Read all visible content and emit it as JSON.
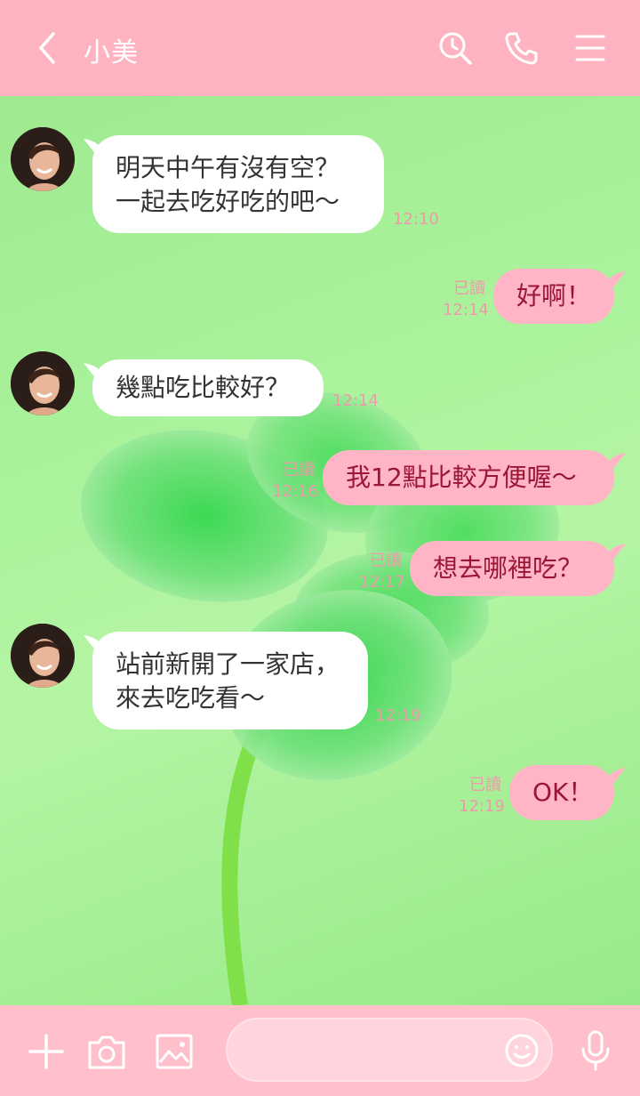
{
  "header": {
    "title": "小美",
    "back_icon": "chevron-left-icon",
    "search_icon": "search-icon",
    "call_icon": "phone-icon",
    "menu_icon": "menu-icon"
  },
  "messages": [
    {
      "side": "in",
      "text": "明天中午有沒有空？\n一起去吃好吃的吧～",
      "time": "12:10"
    },
    {
      "side": "out",
      "text": "好啊！",
      "read": "已讀",
      "time": "12:14"
    },
    {
      "side": "in",
      "text": "幾點吃比較好？",
      "time": "12:14"
    },
    {
      "side": "out",
      "text": "我12點比較方便喔～",
      "read": "已讀",
      "time": "12:16"
    },
    {
      "side": "out",
      "text": "想去哪裡吃？",
      "read": "已讀",
      "time": "12:17"
    },
    {
      "side": "in",
      "text": "站前新開了一家店，\n來去吃吃看～",
      "time": "12:19"
    },
    {
      "side": "out",
      "text": "OK！",
      "read": "已讀",
      "time": "12:19"
    }
  ],
  "footer": {
    "plus_icon": "plus-icon",
    "camera_icon": "camera-icon",
    "image_icon": "image-icon",
    "emoji_icon": "smiley-icon",
    "mic_icon": "microphone-icon",
    "input_value": "",
    "input_placeholder": ""
  },
  "colors": {
    "header_bg": "#ffb3c1",
    "outgoing_bubble": "#ffb5c5",
    "outgoing_text": "#9b1636",
    "incoming_bubble": "#ffffff",
    "timestamp": "#ef9aaa",
    "background": "#a9f29b"
  }
}
